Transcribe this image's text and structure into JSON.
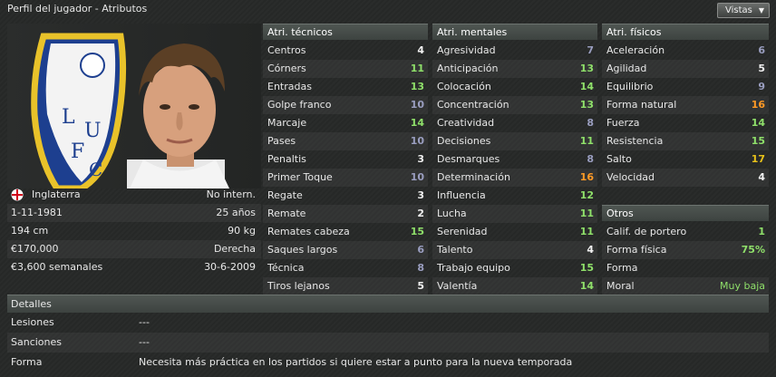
{
  "header": {
    "title": "Perfil del jugador - Atributos",
    "vistas_label": "Vistas"
  },
  "player": {
    "info": [
      {
        "label": "Inglaterra",
        "value": "No intern."
      },
      {
        "label": "1-11-1981",
        "value": "25 años"
      },
      {
        "label": "194 cm",
        "value": "90 kg"
      },
      {
        "label": "€170,000",
        "value": "Derecha"
      },
      {
        "label": "€3,600 semanales",
        "value": "30-6-2009"
      }
    ]
  },
  "technical": {
    "title": "Atri. técnicos",
    "items": [
      {
        "name": "Centros",
        "value": "4",
        "color": "w"
      },
      {
        "name": "Córners",
        "value": "11",
        "color": "g"
      },
      {
        "name": "Entradas",
        "value": "13",
        "color": "g"
      },
      {
        "name": "Golpe franco",
        "value": "10",
        "color": "p"
      },
      {
        "name": "Marcaje",
        "value": "14",
        "color": "g"
      },
      {
        "name": "Pases",
        "value": "10",
        "color": "p"
      },
      {
        "name": "Penaltis",
        "value": "3",
        "color": "w"
      },
      {
        "name": "Primer Toque",
        "value": "10",
        "color": "p"
      },
      {
        "name": "Regate",
        "value": "3",
        "color": "w"
      },
      {
        "name": "Remate",
        "value": "2",
        "color": "w"
      },
      {
        "name": "Remates cabeza",
        "value": "15",
        "color": "g"
      },
      {
        "name": "Saques largos",
        "value": "6",
        "color": "p"
      },
      {
        "name": "Técnica",
        "value": "8",
        "color": "p"
      },
      {
        "name": "Tiros lejanos",
        "value": "5",
        "color": "w"
      }
    ]
  },
  "mental": {
    "title": "Atri. mentales",
    "items": [
      {
        "name": "Agresividad",
        "value": "7",
        "color": "p"
      },
      {
        "name": "Anticipación",
        "value": "13",
        "color": "g"
      },
      {
        "name": "Colocación",
        "value": "14",
        "color": "g"
      },
      {
        "name": "Concentración",
        "value": "13",
        "color": "g"
      },
      {
        "name": "Creatividad",
        "value": "8",
        "color": "p"
      },
      {
        "name": "Decisiones",
        "value": "11",
        "color": "g"
      },
      {
        "name": "Desmarques",
        "value": "8",
        "color": "p"
      },
      {
        "name": "Determinación",
        "value": "16",
        "color": "o"
      },
      {
        "name": "Influencia",
        "value": "12",
        "color": "g"
      },
      {
        "name": "Lucha",
        "value": "11",
        "color": "g"
      },
      {
        "name": "Serenidad",
        "value": "11",
        "color": "g"
      },
      {
        "name": "Talento",
        "value": "4",
        "color": "w"
      },
      {
        "name": "Trabajo equipo",
        "value": "15",
        "color": "g"
      },
      {
        "name": "Valentía",
        "value": "14",
        "color": "g"
      }
    ]
  },
  "physical": {
    "title": "Atri. físicos",
    "items": [
      {
        "name": "Aceleración",
        "value": "6",
        "color": "p"
      },
      {
        "name": "Agilidad",
        "value": "5",
        "color": "w"
      },
      {
        "name": "Equilibrio",
        "value": "9",
        "color": "p"
      },
      {
        "name": "Forma natural",
        "value": "16",
        "color": "o"
      },
      {
        "name": "Fuerza",
        "value": "14",
        "color": "g"
      },
      {
        "name": "Resistencia",
        "value": "15",
        "color": "g"
      },
      {
        "name": "Salto",
        "value": "17",
        "color": "y"
      },
      {
        "name": "Velocidad",
        "value": "4",
        "color": "w"
      }
    ]
  },
  "otros": {
    "title": "Otros",
    "items": [
      {
        "name": "Calif. de portero",
        "value": "1",
        "color": "g"
      },
      {
        "name": "Forma física",
        "value": "75%",
        "color": "g"
      },
      {
        "name": "Forma",
        "value": "",
        "color": "w"
      },
      {
        "name": "Moral",
        "value": "Muy baja",
        "color": "g"
      }
    ]
  },
  "detalles": {
    "title": "Detalles",
    "rows": [
      {
        "label": "Lesiones",
        "value": "---"
      },
      {
        "label": "Sanciones",
        "value": "---"
      },
      {
        "label": "Forma",
        "value": "Necesita más práctica en los partidos si quiere estar a punto para la nueva temporada"
      }
    ]
  },
  "colors": {
    "w": "#f2f2f2",
    "g": "#8fe06a",
    "p": "#9a9ec0",
    "o": "#ff9a26",
    "y": "#e8c21a"
  }
}
